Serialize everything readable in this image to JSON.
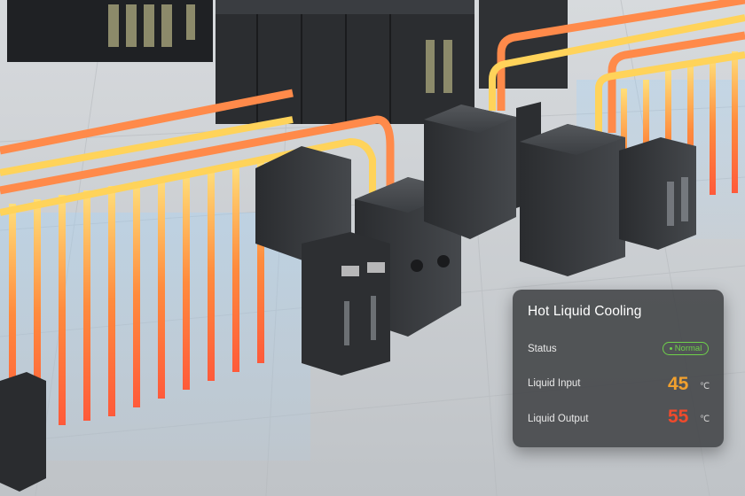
{
  "panel": {
    "title": "Hot Liquid Cooling",
    "status": {
      "label": "Status",
      "value": "Normal",
      "color": "#6fd14a"
    },
    "input": {
      "label": "Liquid Input",
      "value": "45",
      "unit": "℃",
      "color": "#f2a12e"
    },
    "output": {
      "label": "Liquid Output",
      "value": "55",
      "unit": "℃",
      "color": "#ef4a2c"
    }
  },
  "scene": {
    "description_icon": "datacenter-render-icon"
  }
}
